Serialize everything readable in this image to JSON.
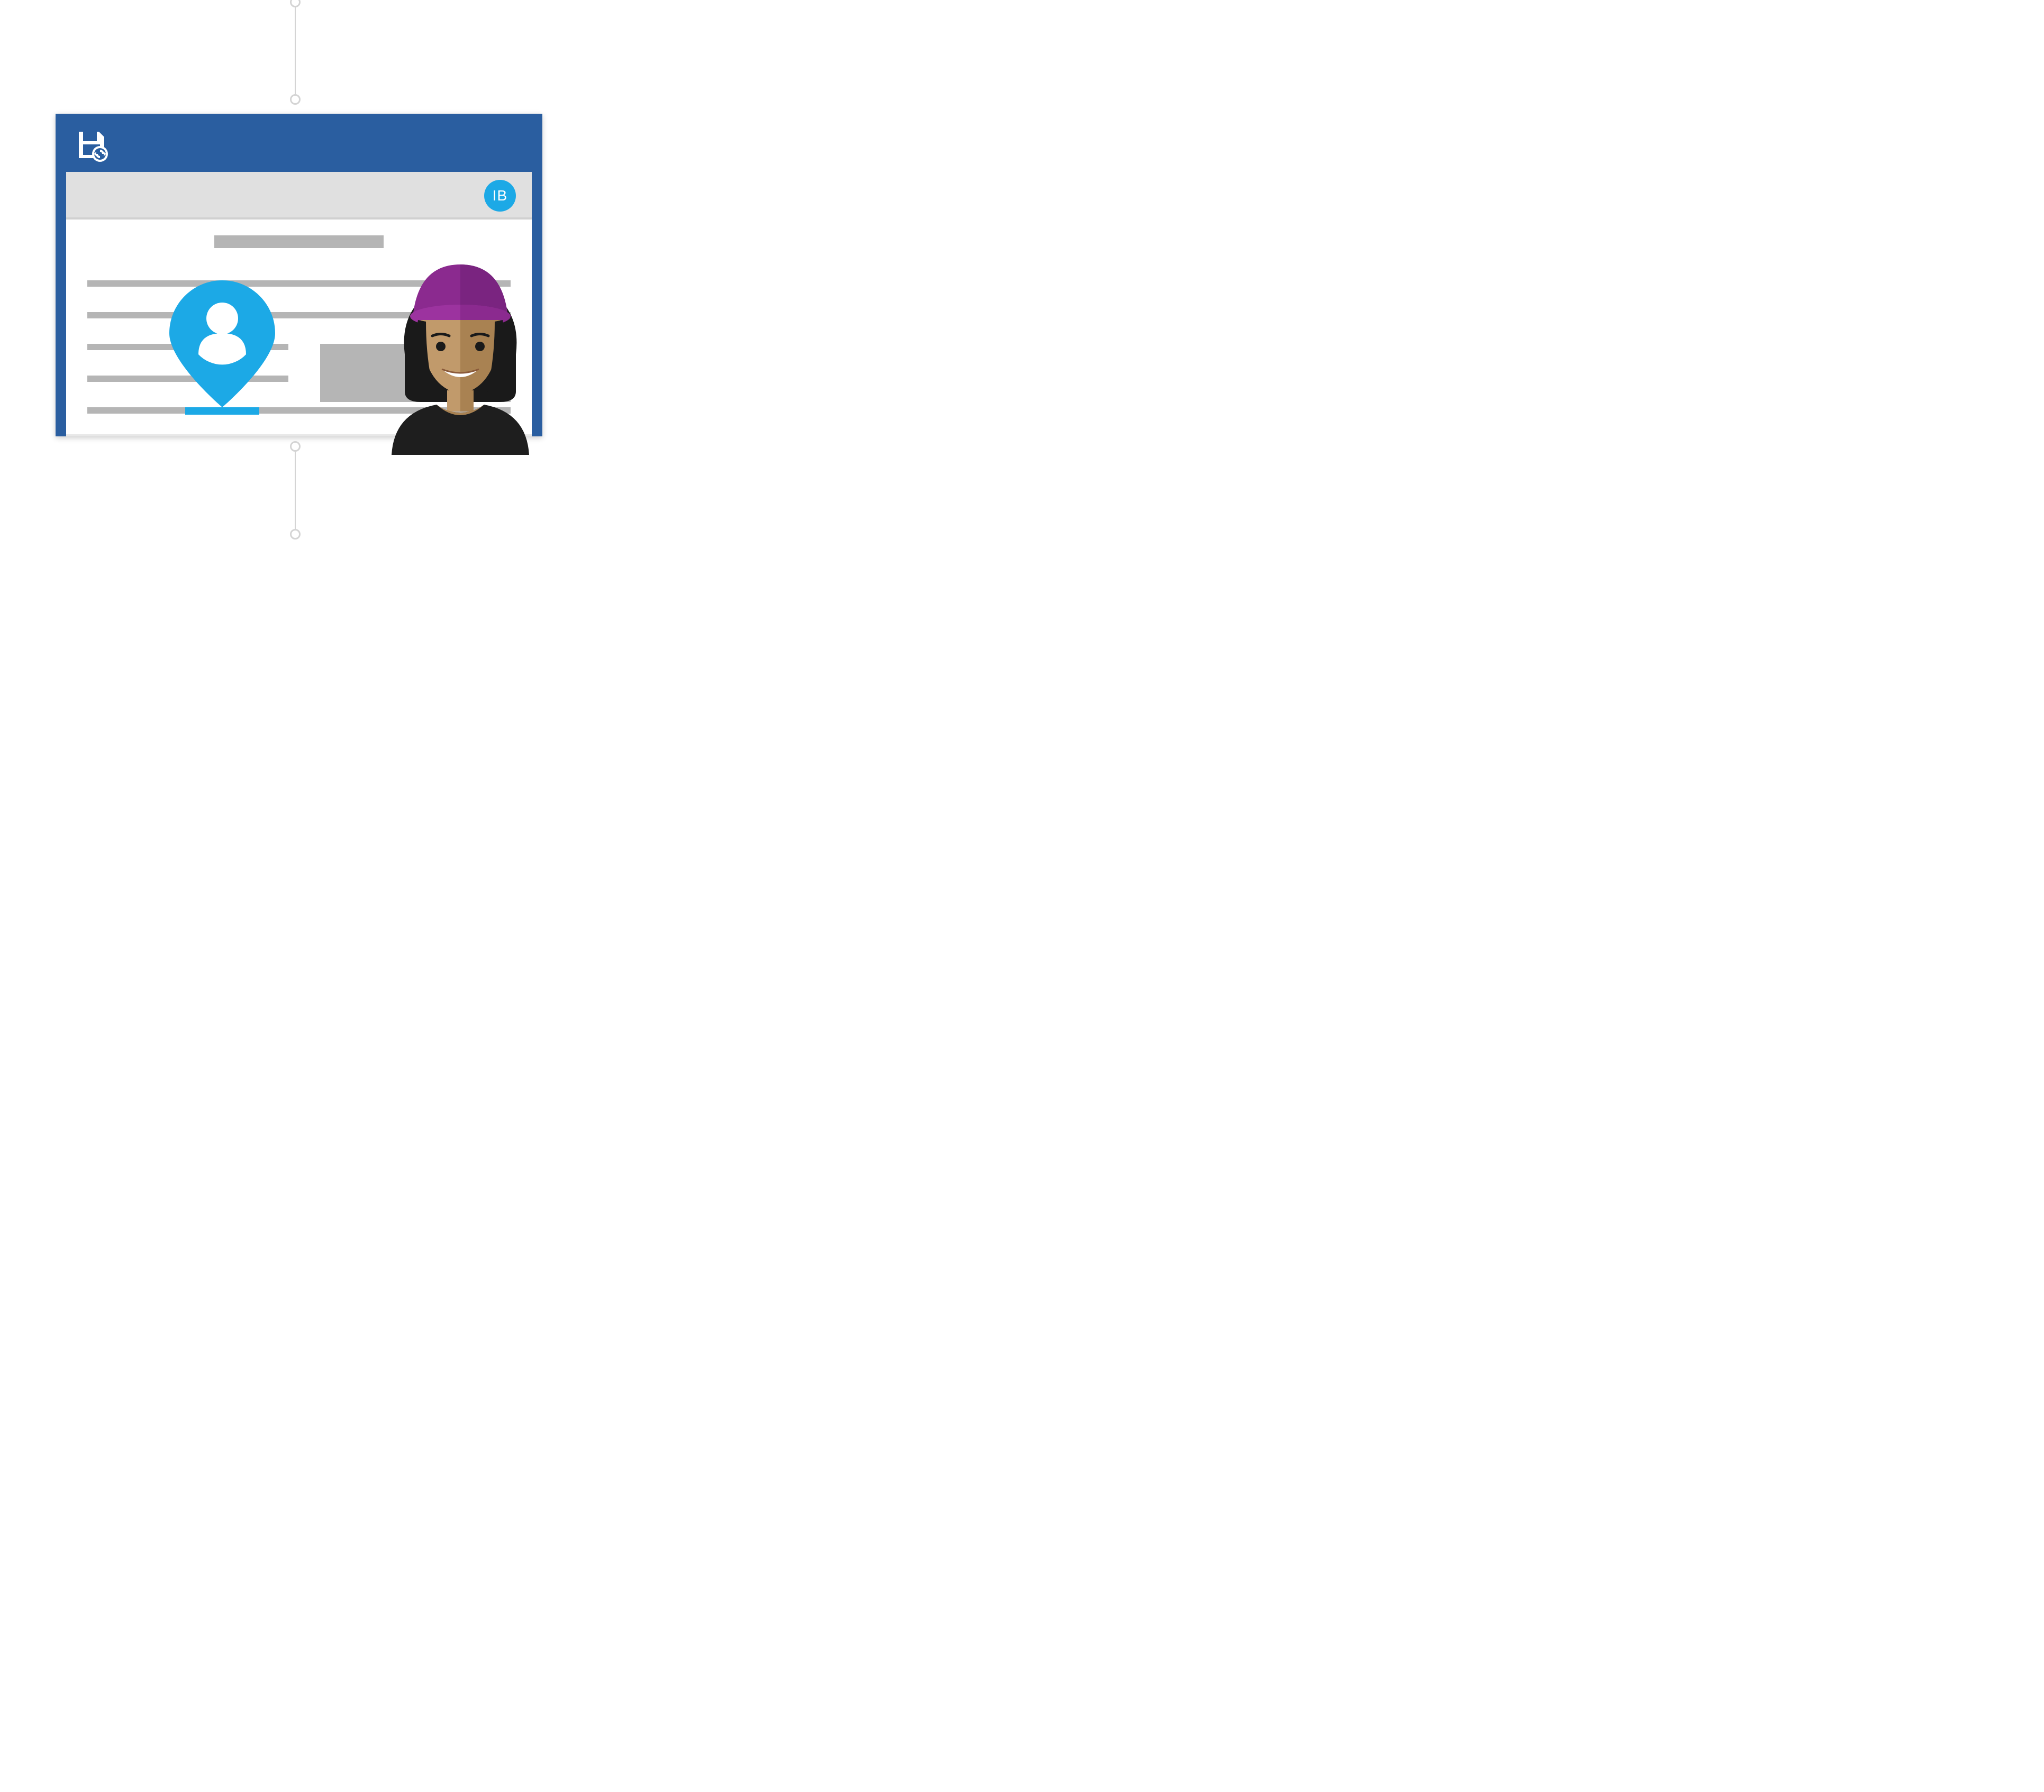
{
  "header": {
    "avatar_initials": "IB"
  },
  "colors": {
    "window_frame": "#2a5ea0",
    "accent": "#1ca9e6",
    "placeholder": "#b5b5b5",
    "header_bar": "#e0e0e0"
  },
  "icons": {
    "titlebar": "save-sync-icon",
    "pin": "person-pin-icon"
  }
}
